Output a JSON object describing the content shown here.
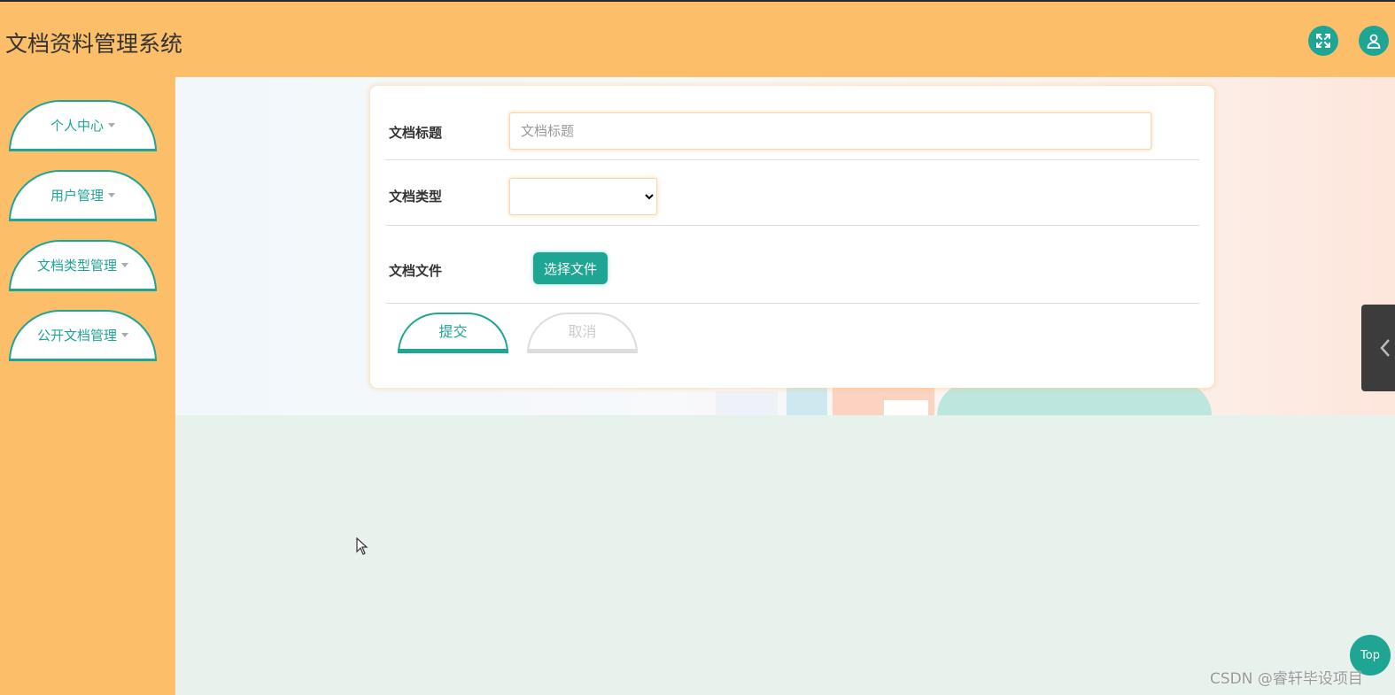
{
  "header": {
    "title": "文档资料管理系统",
    "icons": [
      "fullscreen-icon",
      "user-icon"
    ],
    "bg_color": "#fcbe69",
    "accent_color": "#1fa594"
  },
  "sidebar": {
    "items": [
      {
        "label": "个人中心"
      },
      {
        "label": "用户管理"
      },
      {
        "label": "文档类型管理"
      },
      {
        "label": "公开文档管理"
      }
    ]
  },
  "form": {
    "title_label": "文档标题",
    "title_placeholder": "文档标题",
    "title_value": "",
    "type_label": "文档类型",
    "type_value": "",
    "file_label": "文档文件",
    "file_button": "选择文件",
    "submit_label": "提交",
    "cancel_label": "取消"
  },
  "floating": {
    "top_button": "Top",
    "side_tab_icon": "chevron-left-icon"
  },
  "watermark": "CSDN @睿轩毕设项目"
}
